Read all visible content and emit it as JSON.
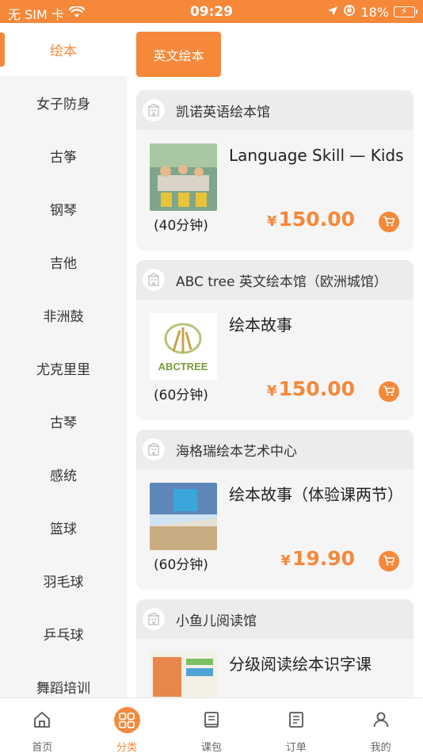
{
  "status_bar": {
    "carrier": "无 SIM 卡",
    "time": "09:29",
    "battery": "18%"
  },
  "sidebar": {
    "items": [
      {
        "label": "绘本",
        "active": true
      },
      {
        "label": "女子防身"
      },
      {
        "label": "古筝"
      },
      {
        "label": "钢琴"
      },
      {
        "label": "吉他"
      },
      {
        "label": "非洲鼓"
      },
      {
        "label": "尤克里里"
      },
      {
        "label": "古琴"
      },
      {
        "label": "感统"
      },
      {
        "label": "篮球"
      },
      {
        "label": "羽毛球"
      },
      {
        "label": "乒乓球"
      },
      {
        "label": "舞蹈培训"
      }
    ]
  },
  "filter": {
    "chip_label": "英文绘本"
  },
  "cards": [
    {
      "shop_name": "凯诺英语绘本馆",
      "course_title": "Language Skill — Kids",
      "duration": "(40分钟)",
      "currency": "¥",
      "price": "150.00"
    },
    {
      "shop_name": "ABC tree 英文绘本馆（欧洲城馆）",
      "course_title": "绘本故事",
      "duration": "(60分钟)",
      "currency": "¥",
      "price": "150.00",
      "logo_text": "ABCTREE"
    },
    {
      "shop_name": "海格瑞绘本艺术中心",
      "course_title": "绘本故事（体验课两节）",
      "duration": "(60分钟)",
      "currency": "¥",
      "price": "19.90"
    },
    {
      "shop_name": "小鱼儿阅读馆",
      "course_title": "分级阅读绘本识字课"
    }
  ],
  "tabbar": {
    "tabs": [
      {
        "label": "首页",
        "icon": "home-icon"
      },
      {
        "label": "分类",
        "icon": "grid-icon",
        "active": true
      },
      {
        "label": "课包",
        "icon": "book-icon"
      },
      {
        "label": "订单",
        "icon": "order-icon"
      },
      {
        "label": "我的",
        "icon": "user-icon"
      }
    ]
  },
  "colors": {
    "accent": "#f6883a",
    "sidebar_bg": "#f5f5f5",
    "card_bg": "#f5f5f5"
  }
}
